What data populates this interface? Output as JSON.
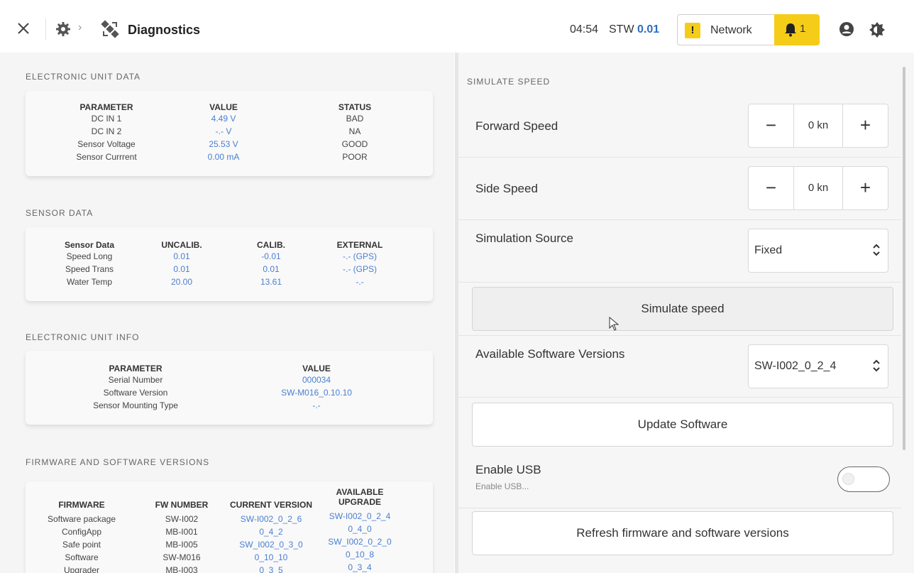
{
  "header": {
    "title": "Diagnostics",
    "time": "04:54",
    "stw_label": "STW",
    "stw_value": "0.01",
    "warning_glyph": "!",
    "network_label": "Network",
    "notification_count": "1"
  },
  "electronic_unit_data": {
    "title": "ELECTRONIC UNIT DATA",
    "headers": [
      "PARAMETER",
      "VALUE",
      "STATUS"
    ],
    "rows": [
      [
        "DC IN 1",
        "4.49 V",
        "BAD"
      ],
      [
        "DC IN 2",
        "-.- V",
        "NA"
      ],
      [
        "Sensor Voltage",
        "25.53 V",
        "GOOD"
      ],
      [
        "Sensor Currrent",
        "0.00 mA",
        "POOR"
      ]
    ]
  },
  "sensor_data": {
    "title": "SENSOR DATA",
    "headers": [
      "Sensor Data",
      "UNCALIB.",
      "CALIB.",
      "EXTERNAL"
    ],
    "rows": [
      [
        "Speed Long",
        "0.01",
        "-0.01",
        "-.- (GPS)"
      ],
      [
        "Speed Trans",
        "0.01",
        "0.01",
        "-.- (GPS)"
      ],
      [
        "Water Temp",
        "20.00",
        "13.61",
        "-.-"
      ]
    ]
  },
  "electronic_unit_info": {
    "title": "ELECTRONIC UNIT INFO",
    "headers": [
      "PARAMETER",
      "VALUE"
    ],
    "rows": [
      [
        "Serial Number",
        "000034"
      ],
      [
        "Software Version",
        "SW-M016_0.10.10"
      ],
      [
        "Sensor Mounting Type",
        "-.-"
      ]
    ]
  },
  "firmware": {
    "title": "FIRMWARE AND SOFTWARE VERSIONS",
    "headers": [
      "FIRMWARE",
      "FW NUMBER",
      "CURRENT VERSION",
      "AVAILABLE",
      "UPGRADE"
    ],
    "rows": [
      [
        "Software package",
        "SW-I002",
        "SW-I002_0_2_6",
        "SW-I002_0_2_4"
      ],
      [
        "ConfigApp",
        "MB-I001",
        "0_4_2",
        "0_4_0"
      ],
      [
        "Safe point",
        "MB-I005",
        "SW_I002_0_3_0",
        "SW_I002_0_2_0"
      ],
      [
        "Software",
        "SW-M016",
        "0_10_10",
        "0_10_8"
      ],
      [
        "Upgrader",
        "MB-I003",
        "0_3_5",
        "0_3_4"
      ]
    ]
  },
  "simulate": {
    "title": "SIMULATE SPEED",
    "forward_label": "Forward Speed",
    "forward_value": "0 kn",
    "side_label": "Side Speed",
    "side_value": "0 kn",
    "source_label": "Simulation Source",
    "source_value": "Fixed",
    "simulate_button": "Simulate speed",
    "versions_label": "Available Software Versions",
    "versions_value": "SW-I002_0_2_4",
    "update_button": "Update Software",
    "usb_label": "Enable USB",
    "usb_sublabel": "Enable USB...",
    "usb_enabled": false,
    "refresh_button": "Refresh firmware and software versions",
    "minus_glyph": "−",
    "plus_glyph": "+"
  }
}
